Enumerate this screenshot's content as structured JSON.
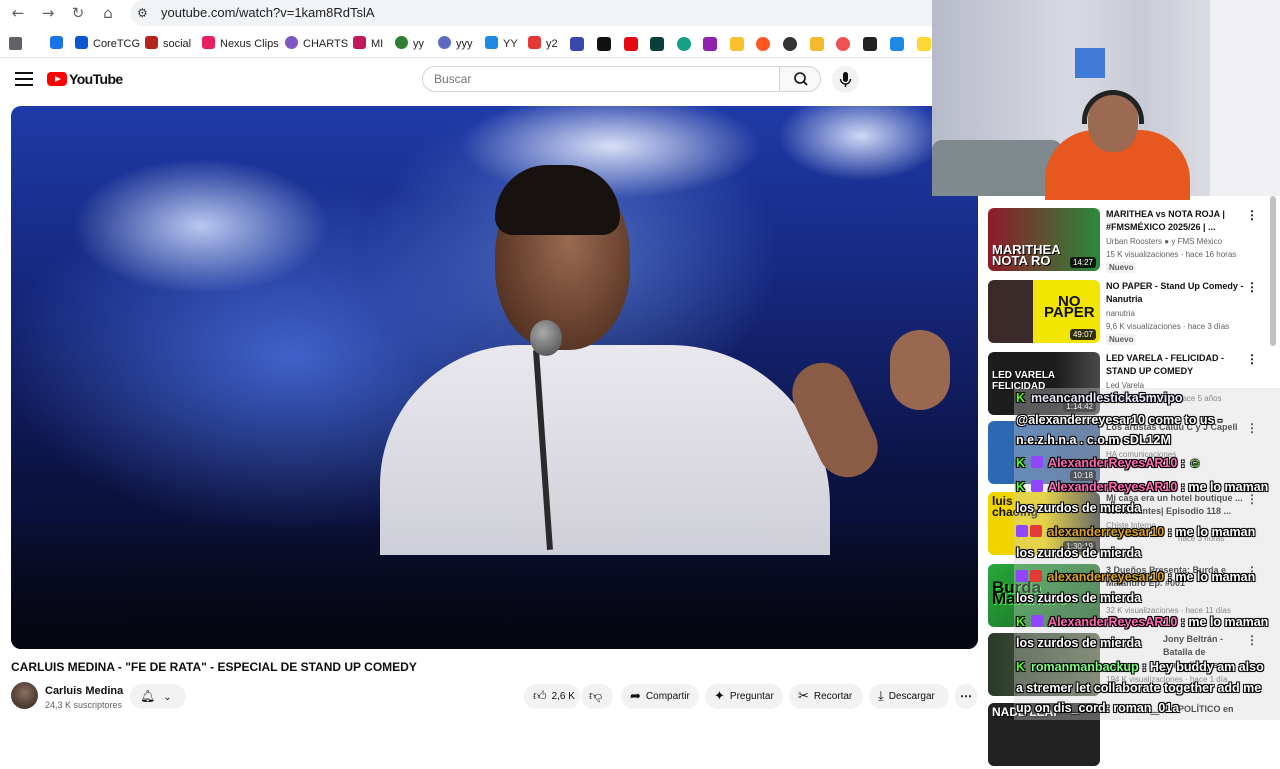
{
  "browser": {
    "url": "youtube.com/watch?v=1kam8RdTslA",
    "bookmarks": [
      {
        "label": "",
        "color": "#1a73e8"
      },
      {
        "label": "CoreTCG",
        "color": "#0b57d0"
      },
      {
        "label": "social",
        "color": "#b3261e"
      },
      {
        "label": "Nexus Clips",
        "color": "#e91e63"
      },
      {
        "label": "CHARTS",
        "color": "#7e57c2"
      },
      {
        "label": "MI",
        "color": "#c2185b"
      },
      {
        "label": "yy",
        "color": "#2e7d32"
      },
      {
        "label": "yyy",
        "color": "#5c6bc0"
      },
      {
        "label": "YY",
        "color": "#1e88e5"
      },
      {
        "label": "y2",
        "color": "#e53935"
      }
    ]
  },
  "youtube": {
    "logo_text": "YouTube",
    "search_placeholder": "Buscar",
    "video": {
      "title": "CARLUIS MEDINA - \"FE DE RATA\" - ESPECIAL DE STAND UP COMEDY",
      "channel": "Carluis Medina",
      "subscribers": "24,3 K suscriptores",
      "likes": "2,6 K",
      "share_label": "Compartir",
      "ask_label": "Preguntar",
      "clip_label": "Recortar",
      "download_label": "Descargar"
    },
    "recommendations": [
      {
        "title": "MARITHEA vs NOTA ROJA | #FMSMÉXICO 2025/26 | ...",
        "channel": "Urban Roosters",
        "channel_extra": "y FMS México",
        "meta": "15 K visualizaciones · hace 16 horas",
        "duration": "14:27",
        "badge": "Nuevo",
        "caption": "MARITHEA\nNOTA RO",
        "thumb_color": "#2a8a3a"
      },
      {
        "title": "NO PAPER - Stand Up Comedy - Nanutria",
        "channel": "nanutria",
        "channel_extra": "",
        "meta": "9,6 K visualizaciones · hace 3 días",
        "duration": "49:07",
        "badge": "Nuevo",
        "caption": "NO\nPAPER",
        "thumb_color": "#f2e600"
      },
      {
        "title": "LED VARELA - FELICIDAD - STAND UP COMEDY",
        "channel": "Led Varela",
        "channel_extra": "",
        "meta": "hace 5 años",
        "duration": "1:14:42",
        "badge": "",
        "caption": "LED VARELA\nFELICIDAD",
        "thumb_color": "#1c1c1c"
      },
      {
        "title": "Los artistas Caluu C y J Capell ... programa ...",
        "channel": "HA comunicaciones",
        "channel_extra": "",
        "meta": "",
        "duration": "10:18",
        "badge": "",
        "caption": "",
        "thumb_color": "#3a5a8a"
      },
      {
        "title": "Mi casa era un hotel boutique ... comediantes| Episodio 118 ...",
        "channel": "Chiste Interno",
        "channel_extra": "",
        "meta": "hace 3 horas",
        "duration": "1:30:19",
        "badge": "",
        "caption": "luis\nchaoing",
        "thumb_color": "#f0d400"
      },
      {
        "title": "3 Dueños Presenta: Burda e Malandro Ep. #001",
        "channel": "",
        "channel_extra": "",
        "meta": "32 K visualizaciones · hace 11 días",
        "duration": "",
        "badge": "",
        "caption": "Burda\nMalandro",
        "thumb_color": "#27a83a"
      },
      {
        "title": "Jony Beltrán - Batalla de comediantes",
        "channel": "",
        "channel_extra": "",
        "meta": "",
        "duration": "",
        "badge": "",
        "caption": "",
        "thumb_color": "#2a3a2a"
      },
      {
        "title": "POLÍTICO en",
        "channel": "",
        "channel_extra": "",
        "meta": "194 K visualizaciones · hace 1 día",
        "duration": "",
        "badge": "",
        "caption": "NADE LEAF",
        "thumb_color": "#222222"
      }
    ]
  },
  "chat": {
    "messages": [
      {
        "platform": "kick",
        "user": "meancandlesticka5mvipo",
        "user_color": "#e8e8ff",
        "text": "",
        "cont": "@alexanderreyesar10 come to us -"
      },
      {
        "platform": "",
        "user": "",
        "user_color": "#ffffff",
        "text": "",
        "cont": "n.e.z.h.n.a . c.o.m sDL12M"
      },
      {
        "platform": "kick",
        "user": "AlexanderReyesAR10",
        "user_color": "#ff69b4",
        "text": ":",
        "cont": ""
      },
      {
        "platform": "kick",
        "user": "AlexanderReyesAR10",
        "user_color": "#ff69b4",
        "text": ": me lo maman",
        "cont": ""
      },
      {
        "platform": "",
        "user": "",
        "user_color": "#ffffff",
        "text": "",
        "cont": "los zurdos de mierda"
      },
      {
        "platform": "twitch",
        "user": "alexanderreyesar10",
        "user_color": "#daa520",
        "text": ": me lo maman",
        "cont": ""
      },
      {
        "platform": "",
        "user": "",
        "user_color": "#ffffff",
        "text": "",
        "cont": "los zurdos de mierda"
      },
      {
        "platform": "twitch",
        "user": "alexanderreyesar10",
        "user_color": "#daa520",
        "text": ": me lo maman",
        "cont": ""
      },
      {
        "platform": "",
        "user": "",
        "user_color": "#ffffff",
        "text": "",
        "cont": "los zurdos de mierda"
      },
      {
        "platform": "kick",
        "user": "AlexanderReyesAR10",
        "user_color": "#ff69b4",
        "text": ": me lo maman",
        "cont": ""
      },
      {
        "platform": "",
        "user": "",
        "user_color": "#ffffff",
        "text": "",
        "cont": "los zurdos de mierda"
      },
      {
        "platform": "kick",
        "user": "romanmanbackup",
        "user_color": "#7fff7f",
        "text": ": Hey buddy am also",
        "cont": ""
      },
      {
        "platform": "",
        "user": "",
        "user_color": "#ffffff",
        "text": "",
        "cont": "a stremer let collaborate together add me"
      },
      {
        "platform": "",
        "user": "",
        "user_color": "#ffffff",
        "text": "",
        "cont": "up on dis_cord: roman_01a"
      }
    ]
  },
  "colors": {
    "accent_red": "#ff0000",
    "kick_green": "#53fc18",
    "twitch_purple": "#9146ff"
  }
}
